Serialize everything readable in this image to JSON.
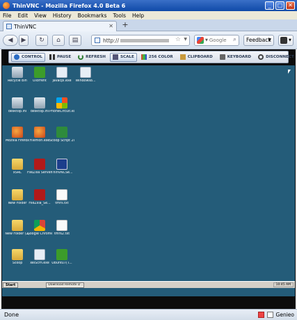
{
  "window": {
    "title": "ThinVNC - Mozilla Firefox 4.0 Beta 6"
  },
  "menubar": [
    "File",
    "Edit",
    "View",
    "History",
    "Bookmarks",
    "Tools",
    "Help"
  ],
  "tab": {
    "label": "ThinVNC",
    "new_tab": "+"
  },
  "nav": {
    "url": "http://",
    "search_placeholder": "Google",
    "feedback": "Feedback"
  },
  "vnc_toolbar": [
    {
      "label": "CONTROL",
      "icon": "control-icon",
      "active": true
    },
    {
      "label": "PAUSE",
      "icon": "pause-icon",
      "active": false
    },
    {
      "label": "REFRESH",
      "icon": "refresh-icon",
      "active": false
    },
    {
      "label": "SCALE",
      "icon": "scale-icon",
      "active": true
    },
    {
      "label": "256 COLOR",
      "icon": "color-icon",
      "active": false
    },
    {
      "label": "CLIPBOARD",
      "icon": "clipboard-icon",
      "active": false
    },
    {
      "label": "KEYBOARD",
      "icon": "keyboard-icon",
      "active": false
    },
    {
      "label": "DISCONNECT",
      "icon": "disconnect-icon",
      "active": false
    }
  ],
  "desktop_icons": [
    {
      "label": "Recycle Bin",
      "glyph": "bin"
    },
    {
      "label": "uTorrent",
      "glyph": "utorrent"
    },
    {
      "label": "javacpl.exe",
      "glyph": "exe"
    },
    {
      "label": "Windows8...",
      "glyph": "exe"
    },
    {
      "label": "desktop.ini",
      "glyph": "bin"
    },
    {
      "label": "desktop.ini",
      "glyph": "bin"
    },
    {
      "label": "PhoneCircuit.exe",
      "glyph": "winxp"
    },
    {
      "label": "Mozilla Firefox",
      "glyph": "firefox"
    },
    {
      "label": "Filemon.exe",
      "glyph": "firefox"
    },
    {
      "label": "Scoop Script 2004",
      "glyph": "green"
    },
    {
      "label": "xSRC",
      "glyph": "folder"
    },
    {
      "label": "FileZilla Server Interface",
      "glyph": "filezilla"
    },
    {
      "label": "ThinVNCSe...",
      "glyph": "thinvnc"
    },
    {
      "label": "New Folder",
      "glyph": "folder"
    },
    {
      "label": "FileZilla_Se...",
      "glyph": "filezilla"
    },
    {
      "label": "tmrs.txt",
      "glyph": "doc"
    },
    {
      "label": "New Folder (2)",
      "glyph": "folder"
    },
    {
      "label": "Google Chrome",
      "glyph": "chrome"
    },
    {
      "label": "tmrs2.txt",
      "glyph": "doc"
    },
    {
      "label": "Scoop",
      "glyph": "folder"
    },
    {
      "label": "xelScrn.exe",
      "glyph": "exe"
    },
    {
      "label": "Ubuntu7(T...",
      "glyph": "utorrent"
    }
  ],
  "taskbar": {
    "start": "Start",
    "task": "Download Remote D ...",
    "clock": "10:45 AM"
  },
  "status": {
    "text": "Done",
    "right_label": "Genieo"
  }
}
